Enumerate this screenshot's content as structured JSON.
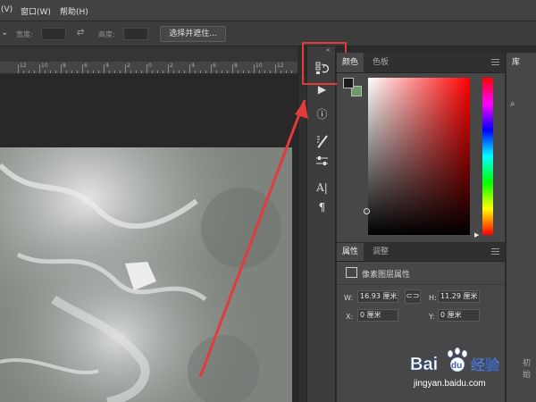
{
  "menubar": {
    "items": [
      "(V)",
      "窗口(W)",
      "帮助(H)"
    ]
  },
  "options_bar": {
    "width_label": "宽度:",
    "height_label": "高度:",
    "select_mask_button": "选择并遮住..."
  },
  "ruler": {
    "ticks": [
      "12",
      "10",
      "8",
      "6",
      "4",
      "2",
      "0",
      "2",
      "4",
      "6",
      "8",
      "10",
      "12",
      "14"
    ]
  },
  "color_panel": {
    "tabs": [
      "颜色",
      "色板"
    ],
    "foreground_color": "#1a1a1a",
    "background_color": "#6e9a68",
    "hue": "#ff0000"
  },
  "properties_panel": {
    "tabs": [
      "属性",
      "调整"
    ],
    "section_title": "像素图层属性",
    "w_label": "W:",
    "w_value": "16.93 厘米",
    "h_label": "H:",
    "h_value": "11.29 厘米",
    "x_label": "X:",
    "x_value": "0 厘米",
    "y_label": "Y:",
    "y_value": "0 厘米"
  },
  "library_panel": {
    "tab": "库",
    "footer_text": "初始"
  },
  "watermark": {
    "brand": "Bai",
    "brand2": "du",
    "label": "经验",
    "url": "jingyan.baidu.com"
  },
  "colors": {
    "highlight": "#e23b3b",
    "accent_blue": "#2e6de0"
  }
}
